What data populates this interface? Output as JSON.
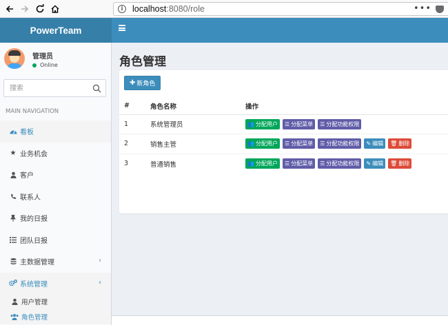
{
  "browser": {
    "url_host": "localhost",
    "url_rest": ":8080/role",
    "more_label": "•••"
  },
  "header": {
    "brand": "PowerTeam"
  },
  "user": {
    "name": "管理员",
    "status": "Online"
  },
  "search": {
    "placeholder": "搜索"
  },
  "sidebar": {
    "nav_header": "MAIN NAVIGATION",
    "items": [
      {
        "label": "看板",
        "icon": "dashboard-icon"
      },
      {
        "label": "业务机会",
        "icon": "star-icon"
      },
      {
        "label": "客户",
        "icon": "user-icon"
      },
      {
        "label": "联系人",
        "icon": "phone-icon"
      },
      {
        "label": "我的日报",
        "icon": "thumbtack-icon"
      },
      {
        "label": "团队日报",
        "icon": "list-icon"
      },
      {
        "label": "主数据管理",
        "icon": "database-icon"
      },
      {
        "label": "系统管理",
        "icon": "cogs-icon"
      }
    ],
    "submenu": [
      {
        "label": "用户管理",
        "icon": "user-icon"
      },
      {
        "label": "角色管理",
        "icon": "users-icon"
      }
    ]
  },
  "main": {
    "title": "角色管理",
    "add_button": "新角色",
    "table": {
      "headers": [
        "#",
        "角色名称",
        "操作"
      ],
      "rows": [
        {
          "num": "1",
          "name": "系统管理员"
        },
        {
          "num": "2",
          "name": "销售主管"
        },
        {
          "num": "3",
          "name": "普通销售"
        }
      ]
    },
    "actions": {
      "assign_users": "分配用户",
      "assign_menu": "分配菜单",
      "assign_perms": "分配功能权限",
      "edit": "编辑",
      "delete": "删除"
    }
  },
  "colors": {
    "primary": "#3c8dbc",
    "brand_bg": "#367fa9",
    "green": "#00a65a",
    "purple": "#605ca8",
    "red": "#dd4b39"
  }
}
